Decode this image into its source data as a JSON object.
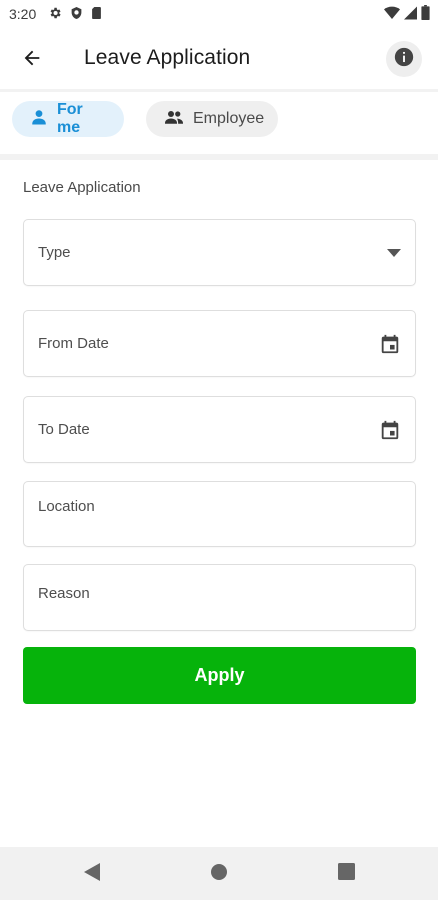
{
  "status_bar": {
    "time": "3:20",
    "left_icons": [
      "settings-icon",
      "shield-icon",
      "sim-card-icon"
    ],
    "right_icons": [
      "wifi-icon",
      "signal-icon",
      "battery-icon"
    ]
  },
  "app_bar": {
    "title": "Leave Application",
    "back_icon": "arrow-back-icon",
    "info_icon": "info-icon"
  },
  "toggle": {
    "options": [
      {
        "label": "For me",
        "icon": "person-icon",
        "selected": true
      },
      {
        "label": "Employee",
        "icon": "people-icon",
        "selected": false
      }
    ]
  },
  "form": {
    "section_label": "Leave Application",
    "fields": {
      "type": {
        "placeholder": "Type",
        "icon": "dropdown-arrow-icon"
      },
      "from_date": {
        "placeholder": "From Date",
        "icon": "calendar-icon"
      },
      "to_date": {
        "placeholder": "To Date",
        "icon": "calendar-icon"
      },
      "location": {
        "placeholder": "Location"
      },
      "reason": {
        "placeholder": "Reason"
      }
    },
    "submit_label": "Apply"
  },
  "nav_bar": {
    "buttons": [
      "back-triangle-icon",
      "home-circle-icon",
      "recents-square-icon"
    ]
  },
  "colors": {
    "accent_blue": "#1a8fd6",
    "chip_active_bg": "#e3f1fb",
    "apply_green": "#06b30b"
  }
}
